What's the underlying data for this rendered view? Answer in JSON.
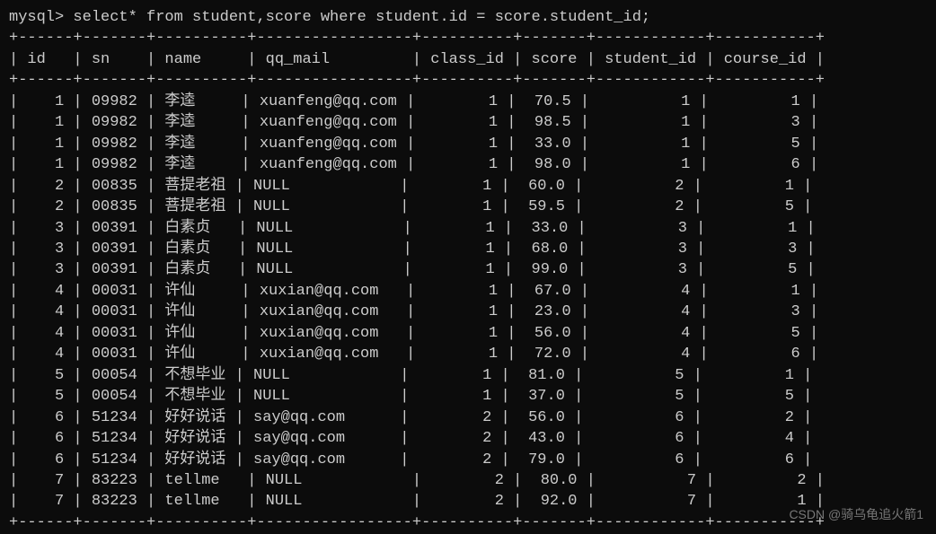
{
  "prompt": "mysql> select* from student,score where student.id = score.student_id;",
  "border_top": "+------+-------+----------+-----------------+----------+-------+------------+-----------+",
  "border_mid": "+------+-------+----------+-----------------+----------+-------+------------+-----------+",
  "border_bottom": "+------+-------+----------+-----------------+----------+-------+------------+-----------+",
  "headers": {
    "id": "id",
    "sn": "sn",
    "name": "name",
    "qq_mail": "qq_mail",
    "class_id": "class_id",
    "score": "score",
    "student_id": "student_id",
    "course_id": "course_id"
  },
  "rows": [
    {
      "id": "1",
      "sn": "09982",
      "name": "李逵",
      "qq_mail": "xuanfeng@qq.com",
      "class_id": "1",
      "score": "70.5",
      "student_id": "1",
      "course_id": "1"
    },
    {
      "id": "1",
      "sn": "09982",
      "name": "李逵",
      "qq_mail": "xuanfeng@qq.com",
      "class_id": "1",
      "score": "98.5",
      "student_id": "1",
      "course_id": "3"
    },
    {
      "id": "1",
      "sn": "09982",
      "name": "李逵",
      "qq_mail": "xuanfeng@qq.com",
      "class_id": "1",
      "score": "33.0",
      "student_id": "1",
      "course_id": "5"
    },
    {
      "id": "1",
      "sn": "09982",
      "name": "李逵",
      "qq_mail": "xuanfeng@qq.com",
      "class_id": "1",
      "score": "98.0",
      "student_id": "1",
      "course_id": "6"
    },
    {
      "id": "2",
      "sn": "00835",
      "name": "菩提老祖",
      "qq_mail": "NULL",
      "class_id": "1",
      "score": "60.0",
      "student_id": "2",
      "course_id": "1"
    },
    {
      "id": "2",
      "sn": "00835",
      "name": "菩提老祖",
      "qq_mail": "NULL",
      "class_id": "1",
      "score": "59.5",
      "student_id": "2",
      "course_id": "5"
    },
    {
      "id": "3",
      "sn": "00391",
      "name": "白素贞",
      "qq_mail": "NULL",
      "class_id": "1",
      "score": "33.0",
      "student_id": "3",
      "course_id": "1"
    },
    {
      "id": "3",
      "sn": "00391",
      "name": "白素贞",
      "qq_mail": "NULL",
      "class_id": "1",
      "score": "68.0",
      "student_id": "3",
      "course_id": "3"
    },
    {
      "id": "3",
      "sn": "00391",
      "name": "白素贞",
      "qq_mail": "NULL",
      "class_id": "1",
      "score": "99.0",
      "student_id": "3",
      "course_id": "5"
    },
    {
      "id": "4",
      "sn": "00031",
      "name": "许仙",
      "qq_mail": "xuxian@qq.com",
      "class_id": "1",
      "score": "67.0",
      "student_id": "4",
      "course_id": "1"
    },
    {
      "id": "4",
      "sn": "00031",
      "name": "许仙",
      "qq_mail": "xuxian@qq.com",
      "class_id": "1",
      "score": "23.0",
      "student_id": "4",
      "course_id": "3"
    },
    {
      "id": "4",
      "sn": "00031",
      "name": "许仙",
      "qq_mail": "xuxian@qq.com",
      "class_id": "1",
      "score": "56.0",
      "student_id": "4",
      "course_id": "5"
    },
    {
      "id": "4",
      "sn": "00031",
      "name": "许仙",
      "qq_mail": "xuxian@qq.com",
      "class_id": "1",
      "score": "72.0",
      "student_id": "4",
      "course_id": "6"
    },
    {
      "id": "5",
      "sn": "00054",
      "name": "不想毕业",
      "qq_mail": "NULL",
      "class_id": "1",
      "score": "81.0",
      "student_id": "5",
      "course_id": "1"
    },
    {
      "id": "5",
      "sn": "00054",
      "name": "不想毕业",
      "qq_mail": "NULL",
      "class_id": "1",
      "score": "37.0",
      "student_id": "5",
      "course_id": "5"
    },
    {
      "id": "6",
      "sn": "51234",
      "name": "好好说话",
      "qq_mail": "say@qq.com",
      "class_id": "2",
      "score": "56.0",
      "student_id": "6",
      "course_id": "2"
    },
    {
      "id": "6",
      "sn": "51234",
      "name": "好好说话",
      "qq_mail": "say@qq.com",
      "class_id": "2",
      "score": "43.0",
      "student_id": "6",
      "course_id": "4"
    },
    {
      "id": "6",
      "sn": "51234",
      "name": "好好说话",
      "qq_mail": "say@qq.com",
      "class_id": "2",
      "score": "79.0",
      "student_id": "6",
      "course_id": "6"
    },
    {
      "id": "7",
      "sn": "83223",
      "name": "tellme",
      "qq_mail": "NULL",
      "class_id": "2",
      "score": "80.0",
      "student_id": "7",
      "course_id": "2"
    },
    {
      "id": "7",
      "sn": "83223",
      "name": "tellme",
      "qq_mail": "NULL",
      "class_id": "2",
      "score": "92.0",
      "student_id": "7",
      "course_id": "1"
    }
  ],
  "watermark": "CSDN @骑乌龟追火箭1"
}
